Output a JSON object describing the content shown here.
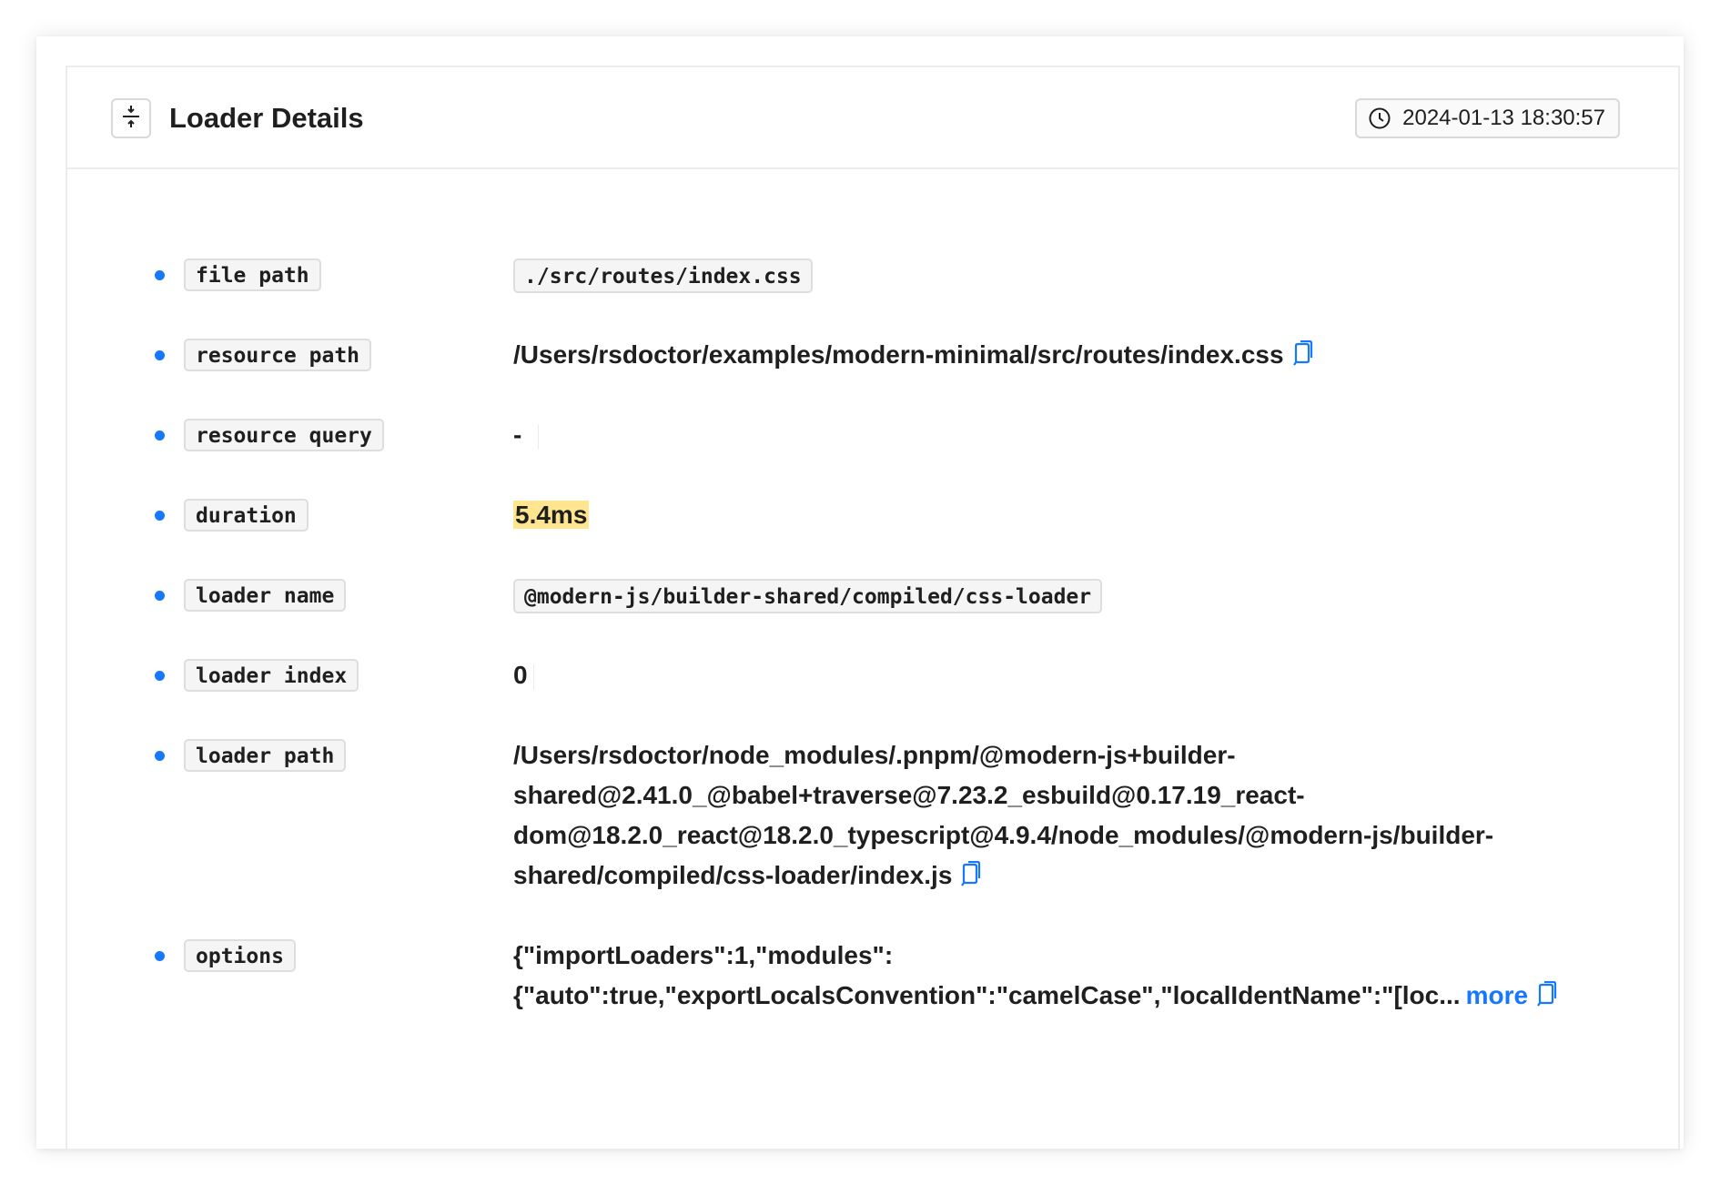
{
  "header": {
    "title": "Loader Details",
    "timestamp": "2024-01-13 18:30:57"
  },
  "details": [
    {
      "label": "file path",
      "value": "./src/routes/index.css"
    },
    {
      "label": "resource path",
      "value": "/Users/rsdoctor/examples/modern-minimal/src/routes/index.css"
    },
    {
      "label": "resource query",
      "value": "-"
    },
    {
      "label": "duration",
      "value": "5.4ms"
    },
    {
      "label": "loader name",
      "value": "@modern-js/builder-shared/compiled/css-loader"
    },
    {
      "label": "loader index",
      "value": "0"
    },
    {
      "label": "loader path",
      "value_lines": [
        "/Users/rsdoctor/node_modules/.pnpm/@modern-js+builder-",
        "shared@2.41.0_@babel+traverse@7.23.2_esbuild@0.17.19_react-",
        "dom@18.2.0_react@18.2.0_typescript@4.9.4/node_modules/@modern-js/builder-",
        "shared/compiled/css-loader/index.js"
      ]
    },
    {
      "label": "options",
      "value_lines": [
        "{\"importLoaders\":1,\"modules\":",
        "{\"auto\":true,\"exportLocalsConvention\":\"camelCase\",\"localIdentName\":\"[loc..."
      ],
      "more": "more"
    }
  ],
  "colors": {
    "accent": "#1677ff",
    "highlight": "#ffe58f",
    "border": "#ececec"
  },
  "icons": {
    "collapse": "collapse-icon",
    "clock": "clock-icon",
    "copy": "copy-icon"
  }
}
